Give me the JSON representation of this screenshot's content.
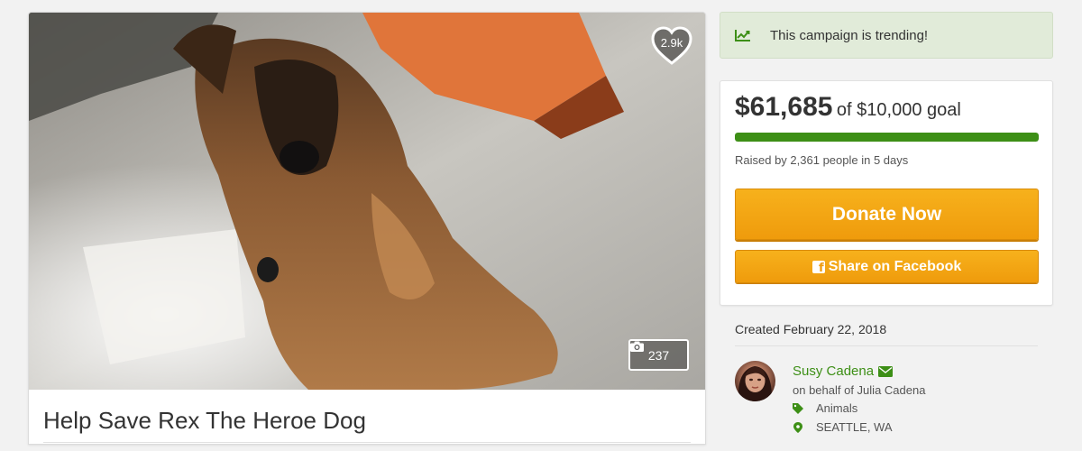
{
  "campaign": {
    "title": "Help Save Rex The Heroe Dog",
    "heart_count": "2.9k",
    "photo_count": "237"
  },
  "trending": {
    "text": "This campaign is trending!",
    "icon": "trend-up-icon"
  },
  "donation": {
    "raised": "$61,685",
    "goal_text": "of $10,000 goal",
    "progress_percent": 100,
    "raised_by": "Raised by 2,361 people in 5 days",
    "donate_label": "Donate Now",
    "share_label": "Share on Facebook"
  },
  "details": {
    "created": "Created February 22, 2018",
    "organizer_name": "Susy Cadena",
    "on_behalf": "on behalf of Julia Cadena",
    "category": "Animals",
    "location": "SEATTLE, WA"
  },
  "colors": {
    "accent_green": "#3d8f16",
    "button_orange": "#f4a414",
    "trending_bg": "#e1ebd9"
  }
}
